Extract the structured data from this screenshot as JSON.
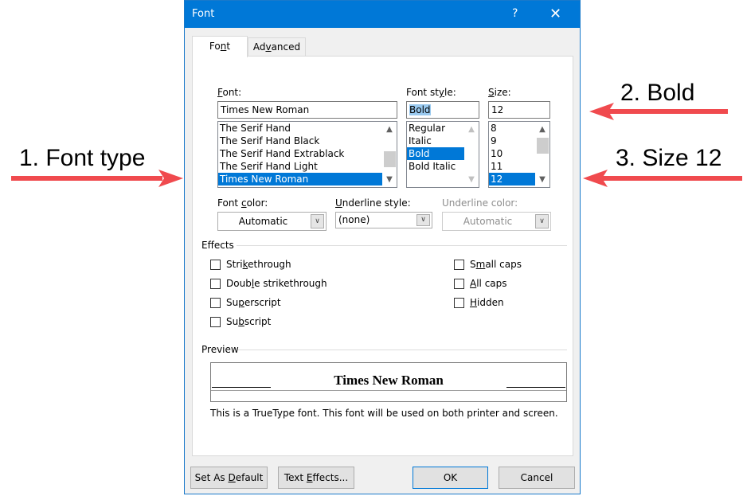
{
  "annotations": {
    "left": "1. Font type",
    "right_top": "2. Bold",
    "right_bottom": "3. Size 12",
    "arrow_color": "#f04a4e"
  },
  "dialog": {
    "title": "Font",
    "help_glyph": "?",
    "close_glyph": "✕",
    "tabs": [
      {
        "label_pre": "Fo",
        "label_u": "n",
        "label_post": "t",
        "active": true
      },
      {
        "label_pre": "Ad",
        "label_u": "v",
        "label_post": "anced",
        "active": false
      }
    ]
  },
  "font": {
    "label_u": "F",
    "label_rest": "ont:",
    "value": "Times New Roman",
    "items": [
      "The Serif Hand",
      "The Serif Hand Black",
      "The Serif Hand Extrablack",
      "The Serif Hand Light",
      "Times New Roman"
    ],
    "selected_index": 4
  },
  "font_style": {
    "label_pre": "Font st",
    "label_u": "y",
    "label_post": "le:",
    "value": "Bold",
    "items": [
      "Regular",
      "Italic",
      "Bold",
      "Bold Italic"
    ],
    "selected_index": 2
  },
  "size": {
    "label_u": "S",
    "label_rest": "ize:",
    "value": "12",
    "items": [
      "8",
      "9",
      "10",
      "11",
      "12"
    ],
    "selected_index": 4
  },
  "font_color": {
    "label_pre": "Font ",
    "label_u": "c",
    "label_post": "olor:",
    "value": "Automatic"
  },
  "underline_style": {
    "label_u": "U",
    "label_rest": "nderline style:",
    "value": "(none)"
  },
  "underline_color": {
    "label": "Underline color:",
    "value": "Automatic",
    "disabled": true
  },
  "effects": {
    "title": "Effects",
    "left": [
      {
        "pre": "Stri",
        "u": "k",
        "post": "ethrough",
        "checked": false
      },
      {
        "pre": "Doub",
        "u": "l",
        "post": "e strikethrough",
        "checked": false
      },
      {
        "pre": "Su",
        "u": "p",
        "post": "erscript",
        "checked": false
      },
      {
        "pre": "Su",
        "u": "b",
        "post": "script",
        "checked": false
      }
    ],
    "right": [
      {
        "pre": "S",
        "u": "m",
        "post": "all caps",
        "checked": false
      },
      {
        "pre": "",
        "u": "A",
        "post": "ll caps",
        "checked": false
      },
      {
        "pre": "",
        "u": "H",
        "post": "idden",
        "checked": false
      }
    ]
  },
  "preview": {
    "title": "Preview",
    "sample": "Times New Roman",
    "note": "This is a TrueType font. This font will be used on both printer and screen."
  },
  "buttons": {
    "set_default": {
      "pre": "Set As ",
      "u": "D",
      "post": "efault"
    },
    "text_effects": {
      "pre": "Text ",
      "u": "E",
      "post": "ffects..."
    },
    "ok": "OK",
    "cancel": "Cancel"
  }
}
